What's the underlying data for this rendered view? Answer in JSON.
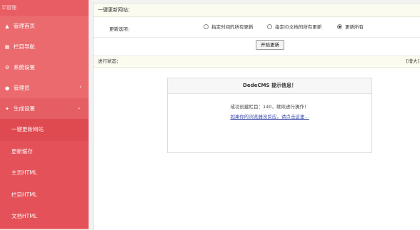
{
  "sidebar": {
    "brand": "平管理",
    "items": [
      {
        "label": "管理首页",
        "icon": "dashboard-icon",
        "glyph": "▲"
      },
      {
        "label": "栏目导航",
        "icon": "grid-icon",
        "glyph": "▦"
      },
      {
        "label": "系统设置",
        "icon": "gear-icon",
        "glyph": "⚙"
      },
      {
        "label": "管理员",
        "icon": "user-icon",
        "glyph": "●",
        "caret": "‹"
      },
      {
        "label": "生成设置",
        "icon": "build-icon",
        "glyph": "✦",
        "caret": "⌄"
      }
    ],
    "submenu": [
      {
        "label": "一键更新网站"
      },
      {
        "label": "更新缓存"
      },
      {
        "label": "主页HTML"
      },
      {
        "label": "栏目HTML"
      },
      {
        "label": "文档HTML"
      }
    ]
  },
  "main": {
    "panel_title": "一键更新网站：",
    "options_label": "更新选项：",
    "options": [
      {
        "label": "指定时间的所有更新",
        "checked": false
      },
      {
        "label": "指定ID文档的所有更新",
        "checked": false
      },
      {
        "label": "更新所有",
        "checked": true
      }
    ],
    "start_button": "开始更新",
    "status_label": "进行状态：",
    "status_right": "[增大]"
  },
  "dialog": {
    "title": "DedeCMS 提示信息！",
    "message": "成功创建栏目：140，继续进行操作！",
    "link": "如果你的浏览器没反应，请点击这里..."
  }
}
